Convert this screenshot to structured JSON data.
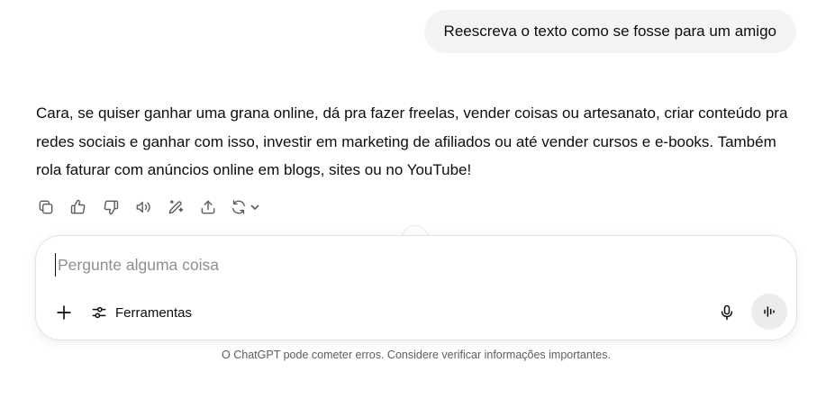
{
  "user_message": {
    "text": "Reescreva o texto como se fosse para um amigo"
  },
  "assistant_message": {
    "text": "Cara, se quiser ganhar uma grana online, dá pra fazer freelas, vender coisas ou artesanato, criar conteúdo pra redes sociais e ganhar com isso, investir em marketing de afiliados ou até vender cursos e e-books. Também rola faturar com anúncios online em blogs, sites ou no YouTube!"
  },
  "message_actions": [
    {
      "icon": "copy-icon"
    },
    {
      "icon": "thumbs-up-icon"
    },
    {
      "icon": "thumbs-down-icon"
    },
    {
      "icon": "read-aloud-icon"
    },
    {
      "icon": "edit-canvas-icon"
    },
    {
      "icon": "share-icon"
    },
    {
      "icon": "regenerate-icon"
    }
  ],
  "composer": {
    "placeholder": "Pergunte alguma coisa",
    "value": "",
    "tools_label": "Ferramentas"
  },
  "footer": {
    "disclaimer": "O ChatGPT pode cometer erros. Considere verificar informações importantes."
  },
  "colors": {
    "bubble_bg": "#f4f4f4",
    "voice_button_bg": "#ececec",
    "text": "#0d0d0d",
    "muted": "#5d5d5d"
  }
}
